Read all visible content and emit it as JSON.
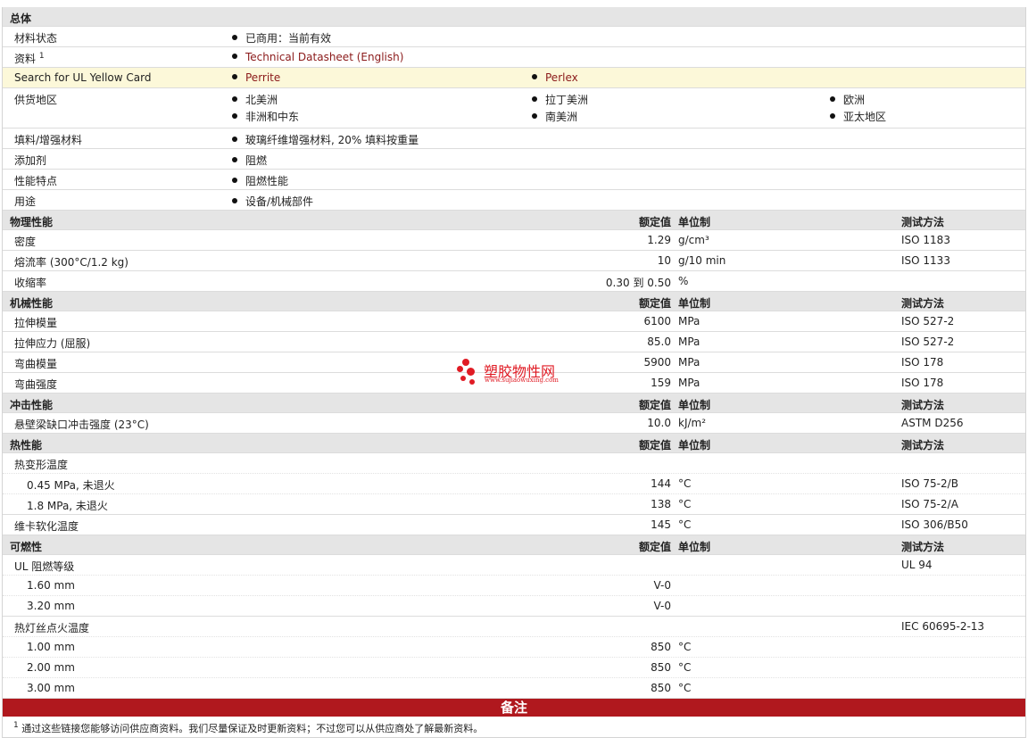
{
  "general": {
    "title": "总体",
    "rows": [
      {
        "label": "材料状态",
        "items": [
          "已商用：当前有效"
        ]
      },
      {
        "label": "资料",
        "sup": "1",
        "links": [
          "Technical Datasheet (English)"
        ]
      },
      {
        "label": "Search for UL Yellow Card",
        "links": [
          "Perrite",
          "Perlex"
        ]
      },
      {
        "label": "供货地区",
        "items": [
          "北美洲",
          "拉丁美洲",
          "欧洲",
          "非洲和中东",
          "南美洲",
          "亚太地区"
        ]
      },
      {
        "label": "填料/增强材料",
        "items": [
          "玻璃纤维增强材料, 20% 填料按重量"
        ]
      },
      {
        "label": "添加剂",
        "items": [
          "阻燃"
        ]
      },
      {
        "label": "性能特点",
        "items": [
          "阻燃性能"
        ]
      },
      {
        "label": "用途",
        "items": [
          "设备/机械部件"
        ]
      }
    ]
  },
  "headers": {
    "value": "额定值",
    "unit": "单位制",
    "test": "测试方法"
  },
  "physical": {
    "title": "物理性能",
    "rows": [
      {
        "label": "密度",
        "value": "1.29",
        "unit": "g/cm³",
        "test": "ISO 1183"
      },
      {
        "label": "熔流率 (300°C/1.2 kg)",
        "value": "10",
        "unit": "g/10 min",
        "test": "ISO 1133"
      },
      {
        "label": "收缩率",
        "value": "0.30 到  0.50",
        "unit": "%",
        "test": ""
      }
    ]
  },
  "mechanical": {
    "title": "机械性能",
    "rows": [
      {
        "label": "拉伸模量",
        "value": "6100",
        "unit": "MPa",
        "test": "ISO 527-2"
      },
      {
        "label": "拉伸应力 (屈服)",
        "value": "85.0",
        "unit": "MPa",
        "test": "ISO 527-2"
      },
      {
        "label": "弯曲模量",
        "value": "5900",
        "unit": "MPa",
        "test": "ISO 178"
      },
      {
        "label": "弯曲强度",
        "value": "159",
        "unit": "MPa",
        "test": "ISO 178"
      }
    ]
  },
  "impact": {
    "title": "冲击性能",
    "rows": [
      {
        "label": "悬壁梁缺口冲击强度 (23°C)",
        "value": "10.0",
        "unit": "kJ/m²",
        "test": "ASTM D256"
      }
    ]
  },
  "thermal": {
    "title": "热性能",
    "rows": [
      {
        "label": "热变形温度",
        "value": "",
        "unit": "",
        "test": ""
      },
      {
        "label": "0.45 MPa, 未退火",
        "value": "144",
        "unit": "°C",
        "test": "ISO 75-2/B"
      },
      {
        "label": "1.8 MPa, 未退火",
        "value": "138",
        "unit": "°C",
        "test": "ISO 75-2/A"
      },
      {
        "label": "维卡软化温度",
        "value": "145",
        "unit": "°C",
        "test": "ISO 306/B50"
      }
    ]
  },
  "flammability": {
    "title": "可燃性",
    "rows": [
      {
        "label": "UL 阻燃等级",
        "value": "",
        "unit": "",
        "test": "UL 94"
      },
      {
        "label": "1.60 mm",
        "value": "V-0",
        "unit": "",
        "test": ""
      },
      {
        "label": "3.20 mm",
        "value": "V-0",
        "unit": "",
        "test": ""
      },
      {
        "label": "热灯丝点火温度",
        "value": "",
        "unit": "",
        "test": "IEC 60695-2-13"
      },
      {
        "label": "1.00 mm",
        "value": "850",
        "unit": "°C",
        "test": ""
      },
      {
        "label": "2.00 mm",
        "value": "850",
        "unit": "°C",
        "test": ""
      },
      {
        "label": "3.00 mm",
        "value": "850",
        "unit": "°C",
        "test": ""
      }
    ]
  },
  "notes": {
    "title": "备注",
    "footnote_mark": "1",
    "footnote": "通过这些链接您能够访问供应商资料。我们尽量保证及时更新资料；不过您可以从供应商处了解最新资料。"
  },
  "watermark": {
    "name": "塑胶物性网",
    "url": "www.sujiaowuxing.com"
  },
  "colors": {
    "accent": "#b0181e",
    "link": "#8b1a1a",
    "highlight": "#fcf8d9",
    "section": "#e5e5e5"
  }
}
